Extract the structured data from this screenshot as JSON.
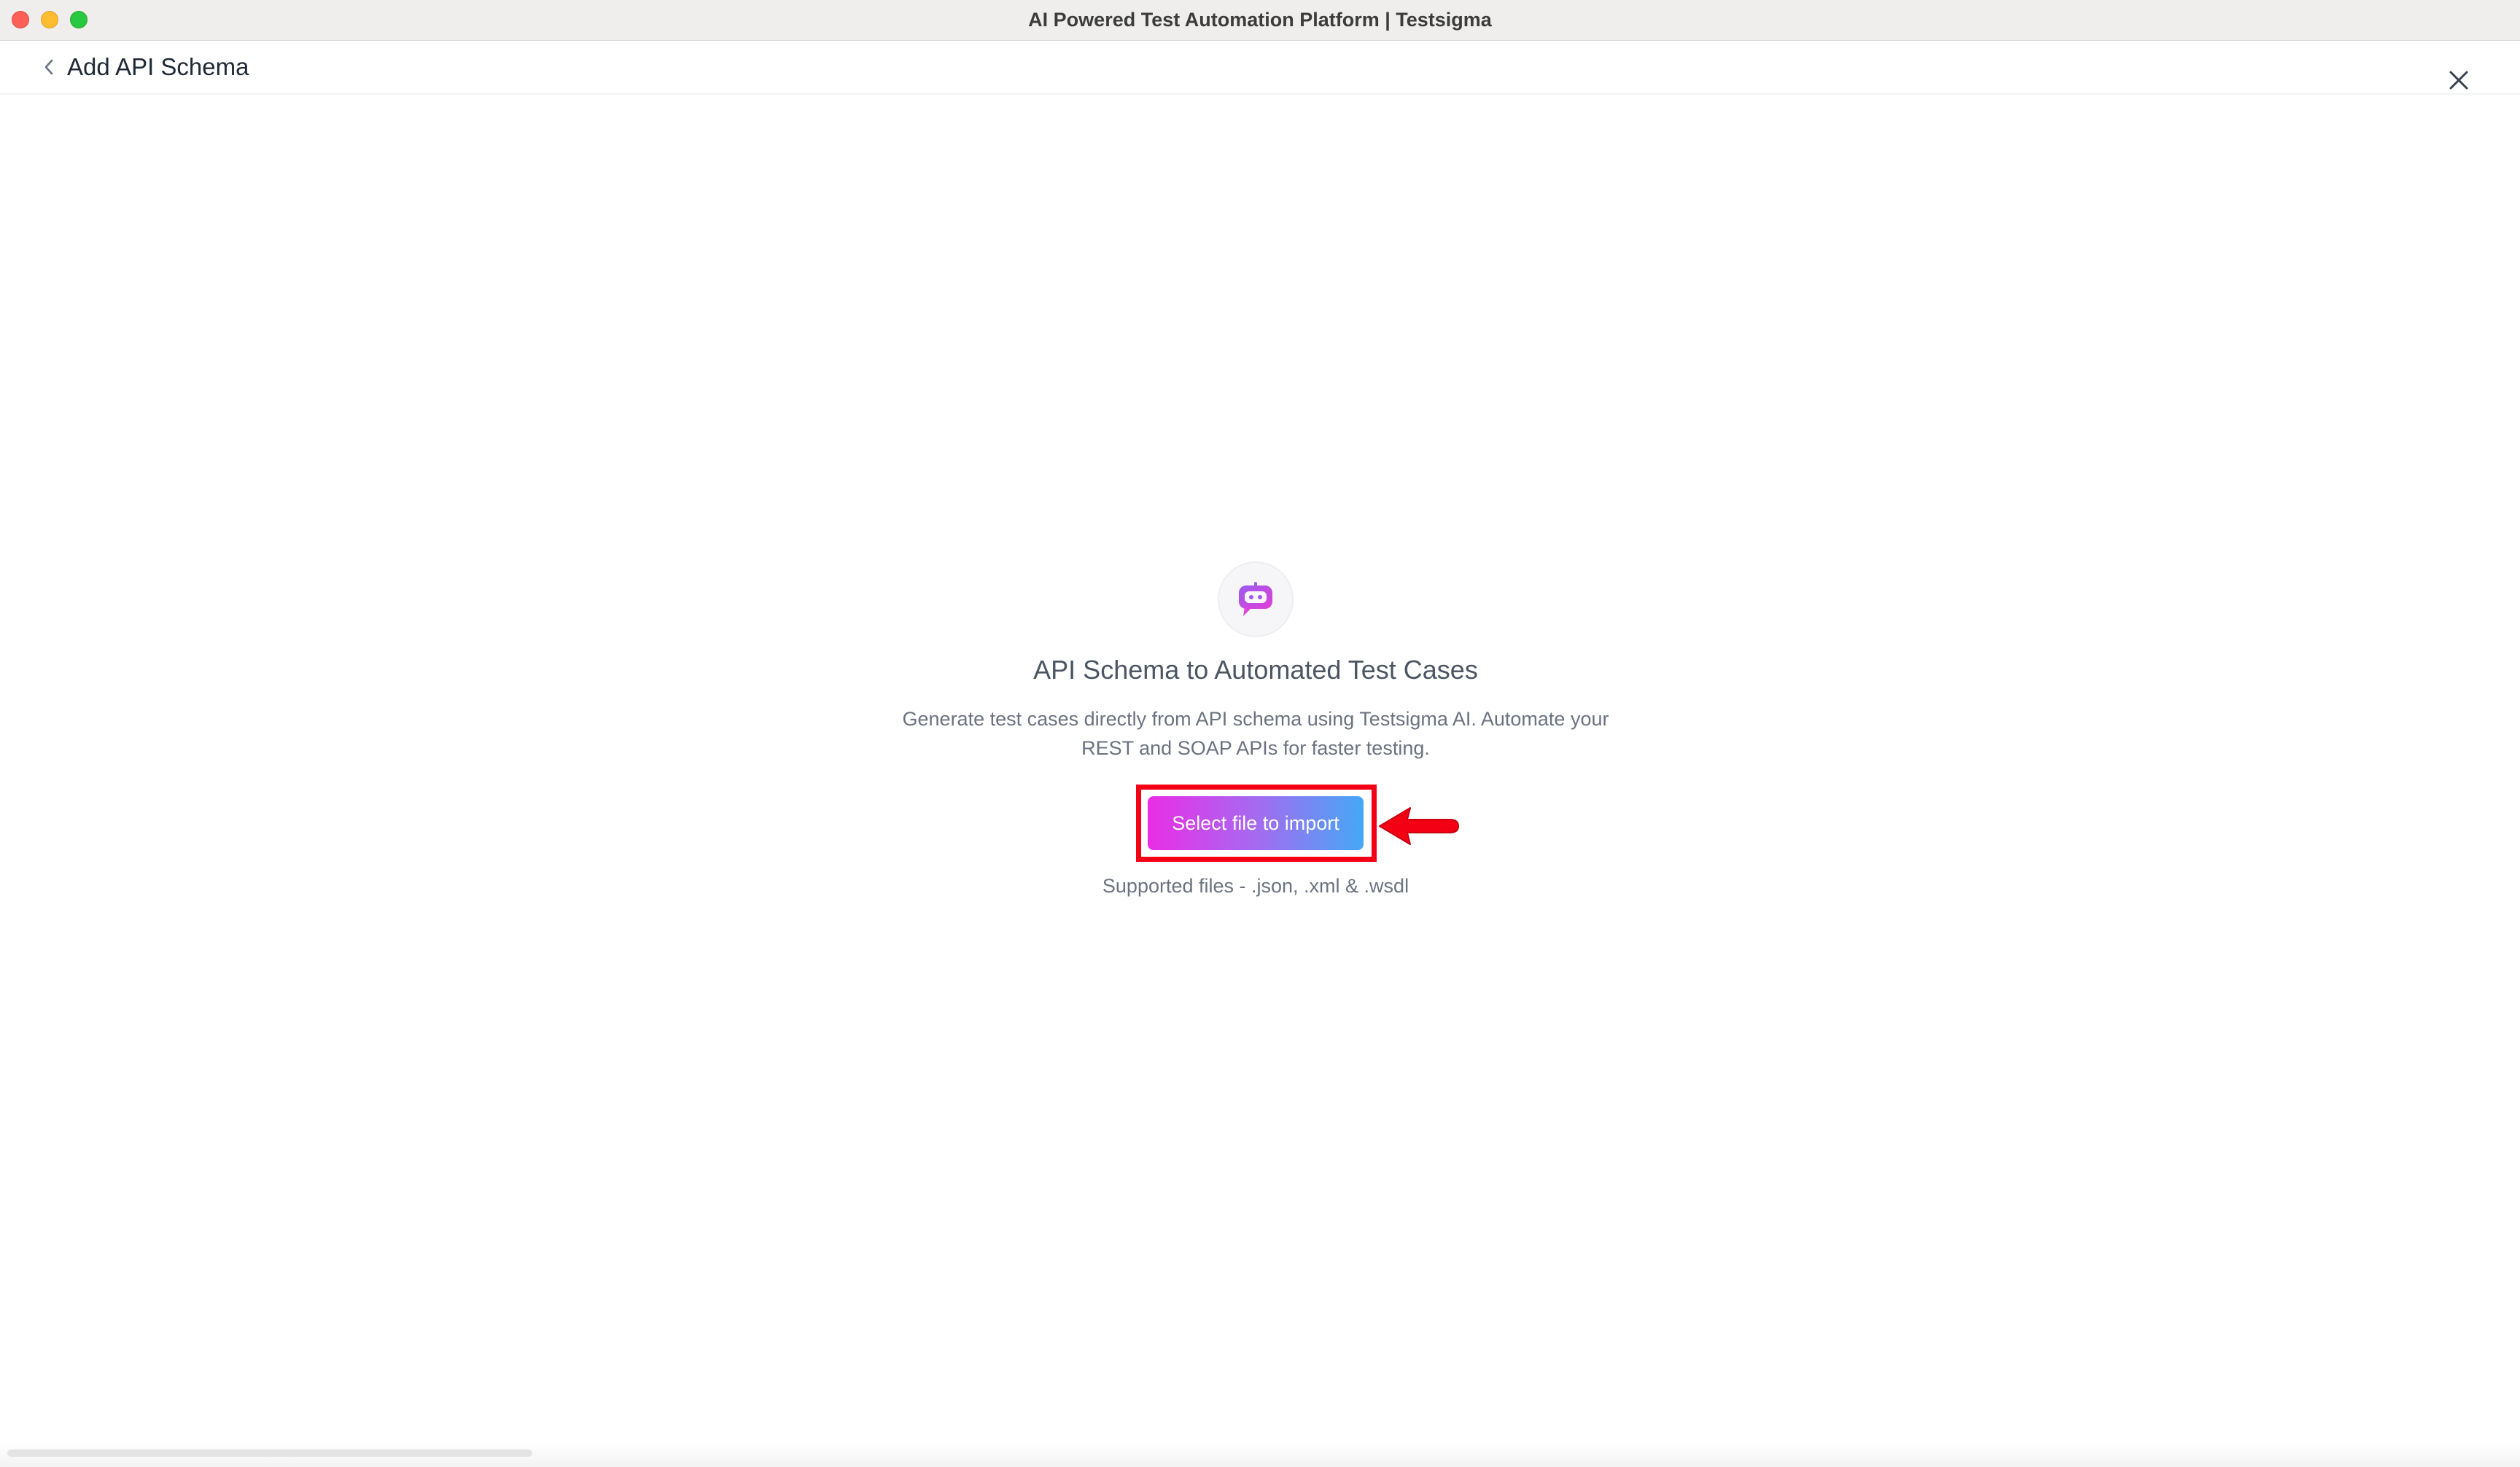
{
  "window": {
    "title": "AI Powered Test Automation Platform | Testsigma"
  },
  "header": {
    "page_title": "Add API Schema"
  },
  "main": {
    "heading": "API Schema to Automated Test Cases",
    "description": "Generate test cases directly from API schema using Testsigma AI. Automate your REST and SOAP APIs for faster testing.",
    "import_button_label": "Select file to import",
    "supported_files": "Supported files - .json, .xml & .wsdl"
  },
  "icons": {
    "back": "chevron-left-icon",
    "close": "close-icon",
    "hero": "chat-bot-icon",
    "annotation": "red-arrow-icon"
  },
  "colors": {
    "highlight": "#f40014",
    "button_gradient_start": "#ea2de5",
    "button_gradient_end": "#45a8f6"
  }
}
